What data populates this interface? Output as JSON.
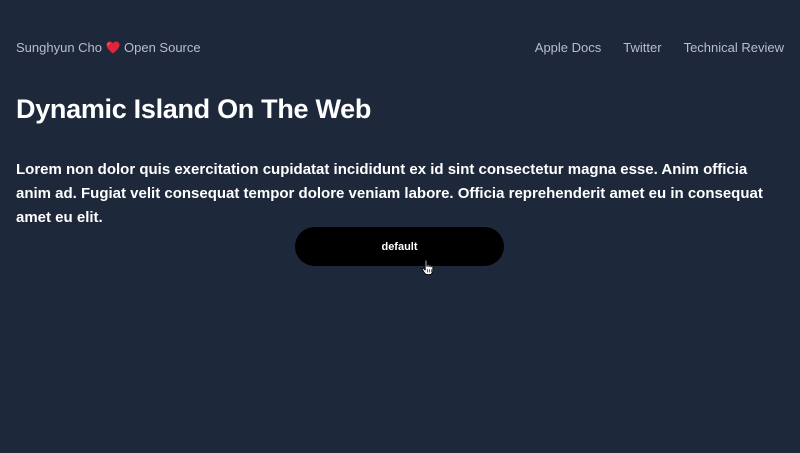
{
  "nav": {
    "brand_name": "Sunghyun Cho",
    "brand_suffix": "Open Source",
    "brand_icon": "heart-icon",
    "links": [
      "Apple Docs",
      "Twitter",
      "Technical Review"
    ]
  },
  "main": {
    "title": "Dynamic Island On The Web",
    "paragraph": "Lorem non dolor quis exercitation cupidatat incididunt ex id sint consectetur magna esse. Anim officia anim ad. Fugiat velit consequat tempor dolore veniam labore. Officia reprehenderit amet eu in consequat amet eu elit.",
    "island_label": "default"
  },
  "colors": {
    "background": "#1e283b",
    "nav_text": "#b6bfcc",
    "heart": "#e0243a",
    "island": "#000000",
    "text": "#ffffff"
  }
}
